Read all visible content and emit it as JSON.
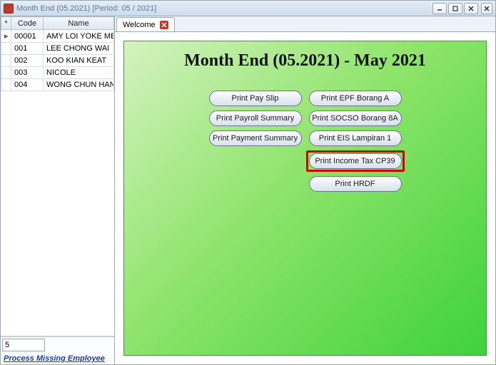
{
  "window": {
    "title": "Month End (05.2021) [Period: 05 / 2021]"
  },
  "sidebar": {
    "columns": {
      "code": "Code",
      "name": "Name"
    },
    "rows": [
      {
        "code": "00001",
        "name": "AMY LOI YOKE MEI"
      },
      {
        "code": "001",
        "name": "LEE CHONG WAI"
      },
      {
        "code": "002",
        "name": "KOO KIAN KEAT"
      },
      {
        "code": "003",
        "name": "NICOLE"
      },
      {
        "code": "004",
        "name": "WONG CHUN HAN"
      }
    ],
    "count": "5",
    "footer_link": "Process Missing Employee"
  },
  "tabs": [
    {
      "label": "Welcome"
    }
  ],
  "panel": {
    "title": "Month End (05.2021) - May 2021",
    "buttons": {
      "pay_slip": "Print Pay Slip",
      "epf": "Print EPF Borang A",
      "payroll_summary": "Print Payroll Summary",
      "socso": "Print SOCSO Borang 8A",
      "payment_summary": "Print Payment Summary",
      "eis": "Print EIS Lampiran 1",
      "income_tax": "Print Income Tax CP39",
      "hrdf": "Print HRDF"
    }
  }
}
